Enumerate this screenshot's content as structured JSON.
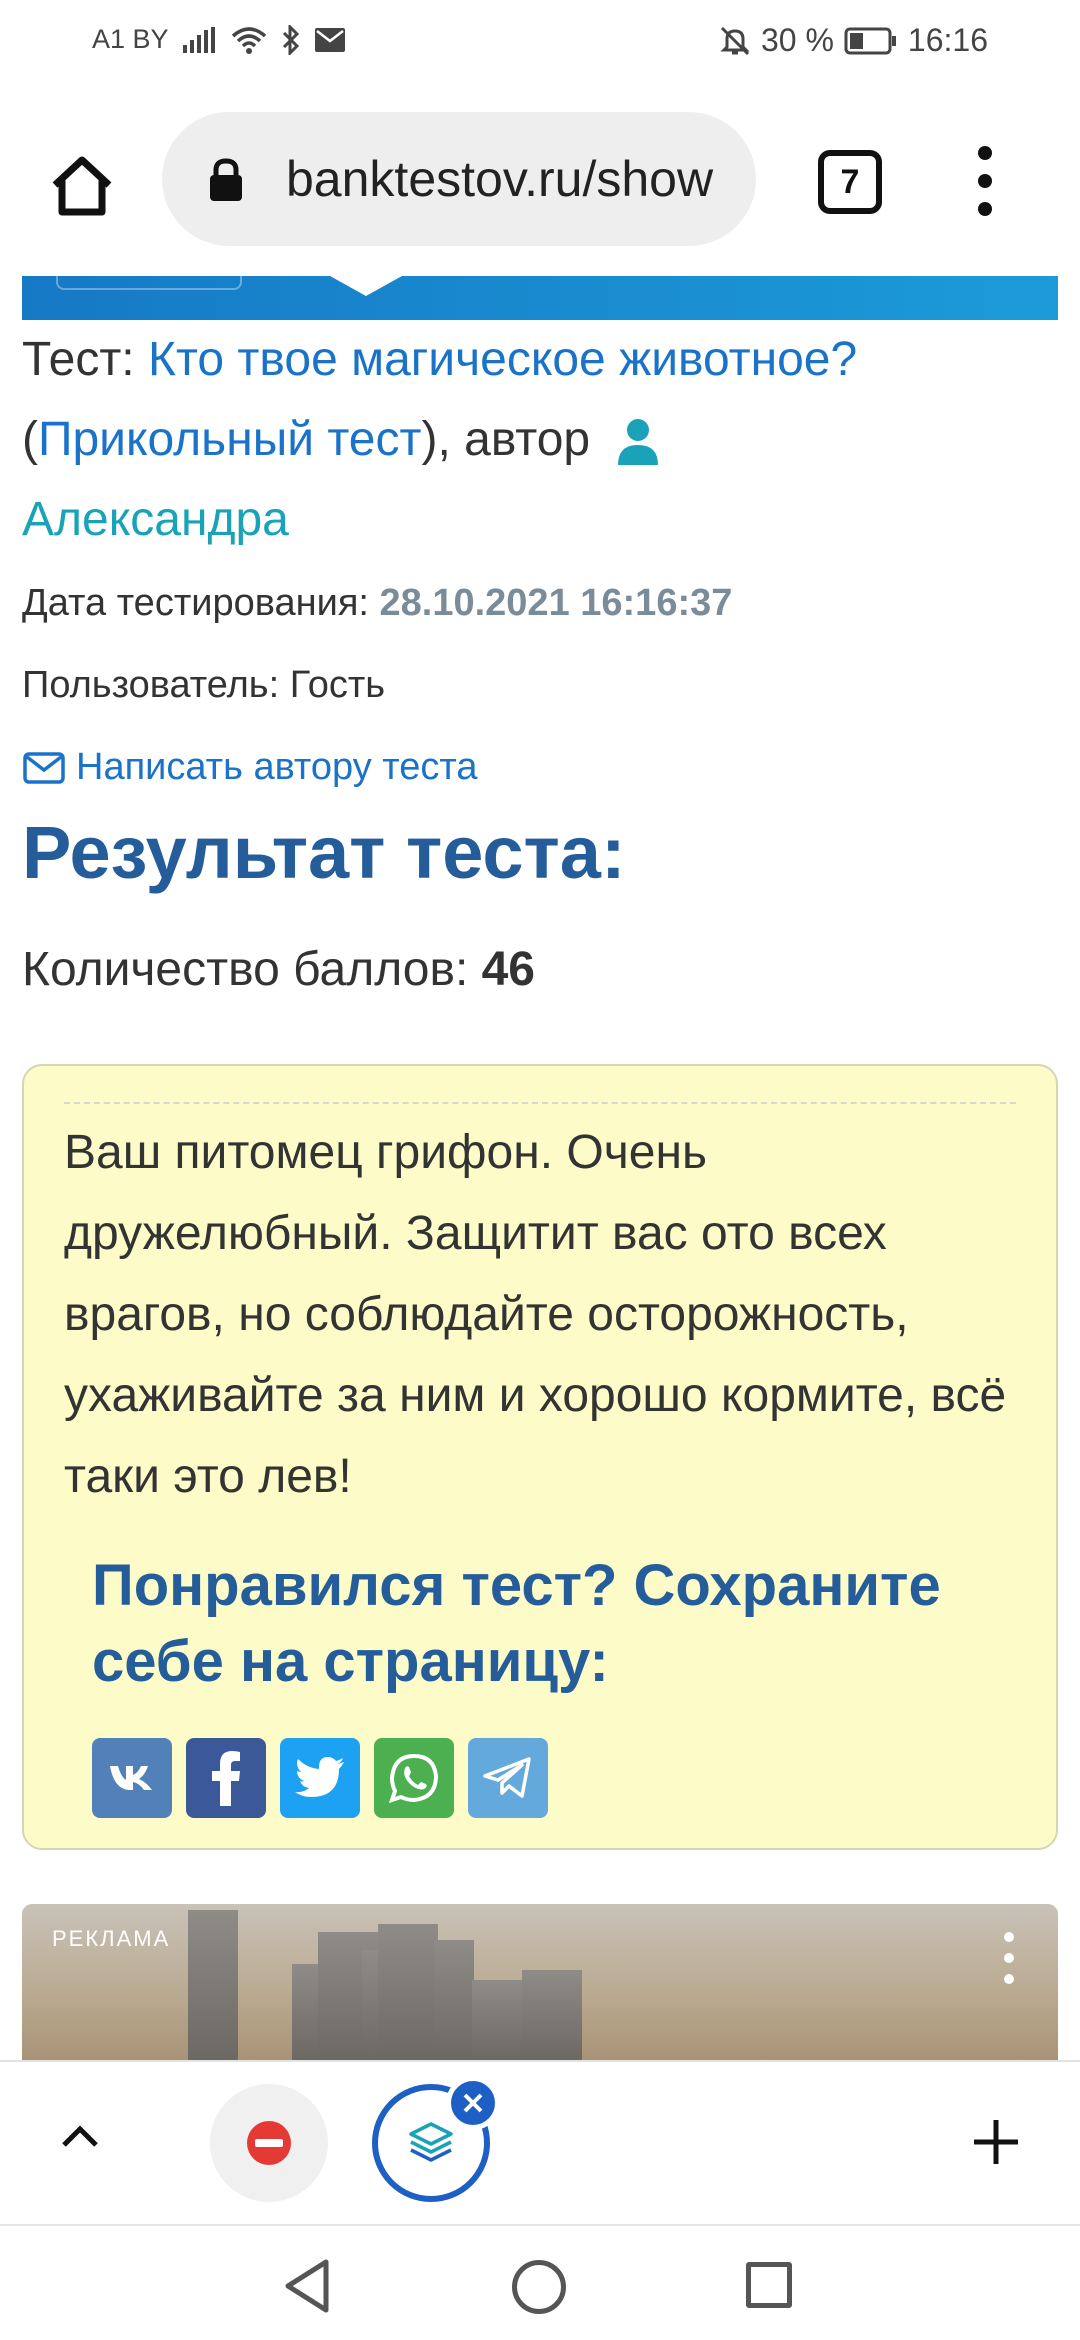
{
  "status_bar": {
    "carrier": "A1 BY",
    "battery": "30 %",
    "time": "16:16"
  },
  "browser": {
    "url": "banktestov.ru/show",
    "tab_count": "7"
  },
  "test_info": {
    "test_prefix": "Тест: ",
    "test_title": "Кто твое магическое животное?",
    "open_paren": "(",
    "category": "Прикольный тест",
    "author_prefix": "), автор",
    "author": "Александра",
    "date_label": "Дата тестирования: ",
    "date_value": "28.10.2021 16:16:37",
    "user_label": "Пользователь: Гость",
    "write_author": "Написать автору теста"
  },
  "result": {
    "title": "Результат теста:",
    "score_label": "Количество баллов: ",
    "score_value": "46",
    "text": "Ваш питомец грифон. Очень дружелюбный. Защитит вас ото всех врагов, но соблюдайте осторожность, ухаживайте за ним и хорошо кормите, всё таки это лев!",
    "share_title": "Понравился тест? Сохраните себе на страницу:"
  },
  "share_buttons": [
    {
      "icon": "vk-icon",
      "color": "#5181b8"
    },
    {
      "icon": "facebook-icon",
      "color": "#3b5998"
    },
    {
      "icon": "twitter-icon",
      "color": "#1da1f2"
    },
    {
      "icon": "whatsapp-icon",
      "color": "#4caf50"
    },
    {
      "icon": "telegram-icon",
      "color": "#64a9dc"
    }
  ],
  "ad": {
    "label": "РЕКЛАМА"
  },
  "colors": {
    "link": "#1a73c9",
    "author_link": "#1aa3b8",
    "heading": "#245d9a",
    "result_bg": "#fdfcc9",
    "toolbar_accent": "#1d5fc4"
  }
}
